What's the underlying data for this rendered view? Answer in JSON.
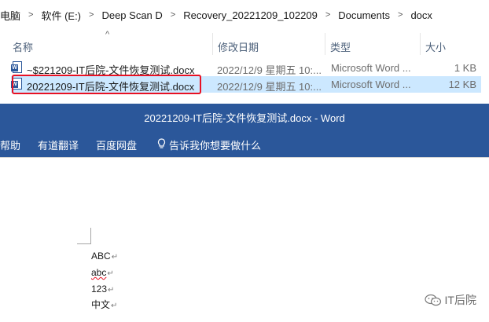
{
  "explorer": {
    "breadcrumb": [
      "电脑",
      "软件 (E:)",
      "Deep Scan D",
      "Recovery_20221209_102209",
      "Documents",
      "docx"
    ],
    "breadcrumb_separator": ">",
    "columns": {
      "name": "名称",
      "date": "修改日期",
      "type": "类型",
      "size": "大小"
    },
    "sort_indicator": "^",
    "files": [
      {
        "name": "~$221209-IT后院-文件恢复测试.docx",
        "date": "2022/12/9 星期五 10:...",
        "type": "Microsoft Word ...",
        "size": "1 KB",
        "selected": false
      },
      {
        "name": "20221209-IT后院-文件恢复测试.docx",
        "date": "2022/12/9 星期五 10:...",
        "type": "Microsoft Word ...",
        "size": "12 KB",
        "selected": true
      }
    ]
  },
  "word": {
    "title": "20221209-IT后院-文件恢复测试.docx - Word",
    "ribbon": {
      "help": "帮助",
      "youdao": "有道翻译",
      "baidu": "百度网盘",
      "tellme": "告诉我你想要做什么"
    },
    "doc_lines": [
      "ABC",
      "abc",
      "123",
      "中文"
    ],
    "paragraph_mark": "↵"
  },
  "watermark": {
    "text": "IT后院"
  },
  "colors": {
    "word_blue": "#2b579a",
    "selection": "#cce8ff",
    "highlight_red": "#e81123"
  }
}
